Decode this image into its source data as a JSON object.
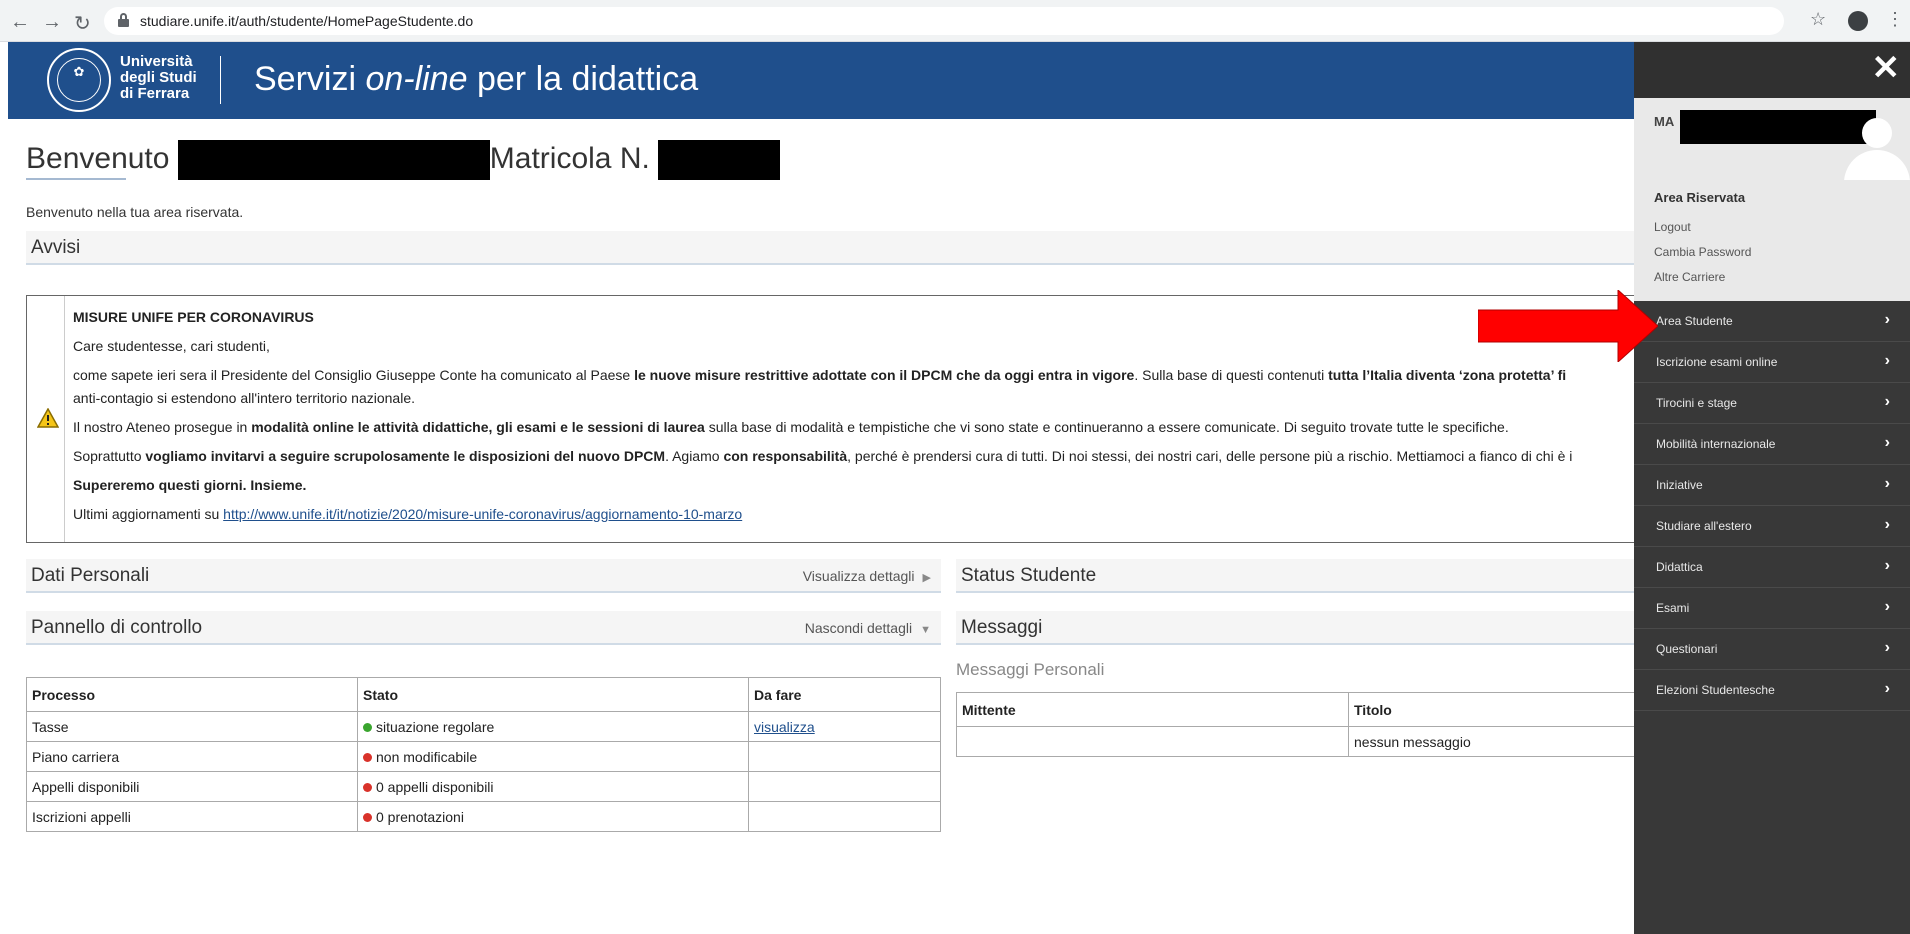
{
  "browser": {
    "url": "studiare.unife.it/auth/studente/HomePageStudente.do"
  },
  "header": {
    "university_line1": "Università",
    "university_line2": "degli Studi",
    "university_line3": "di Ferrara",
    "title_part1": "Servizi ",
    "title_italic": "on-line",
    "title_part2": " per la didattica"
  },
  "welcome": {
    "title_prefix": "Benvenuto ",
    "title_matricola": "Matricola N. ",
    "subtitle": "Benvenuto nella tua area riservata."
  },
  "avvisi": {
    "heading": "Avvisi",
    "title": "MISURE UNIFE PER CORONAVIRUS",
    "greeting": "Care studentesse, cari studenti,",
    "p1_a": "come sapete ieri sera il Presidente del Consiglio Giuseppe Conte ha comunicato al Paese ",
    "p1_b": "le nuove misure restrittive adottate con il DPCM che da oggi entra in vigore",
    "p1_c": ". Sulla base di questi contenuti ",
    "p1_d": "tutta l’Italia diventa ‘zona protetta’ fi",
    "p1_line2": "anti-contagio si estendono all'intero territorio nazionale.",
    "p2_a": "Il nostro Ateneo prosegue in ",
    "p2_b": "modalità online le attività didattiche, gli esami e le sessioni di laurea",
    "p2_c": " sulla base di modalità e tempistiche che vi sono state e continueranno a essere comunicate. Di seguito trovate tutte le specifiche.",
    "p3_a": "Soprattutto ",
    "p3_b": "vogliamo invitarvi a seguire scrupolosamente le disposizioni del nuovo DPCM",
    "p3_c": ". Agiamo ",
    "p3_d": "con responsabilità",
    "p3_e": ", perché è prendersi cura di tutti. Di noi stessi, dei nostri cari, delle persone più a rischio. Mettiamoci a fianco di chi è i",
    "p4": "Supereremo questi giorni. Insieme.",
    "p5_a": "Ultimi aggiornamenti su ",
    "p5_link": "http://www.unife.it/it/notizie/2020/misure-unife-coronavirus/aggiornamento-10-marzo"
  },
  "dati_personali": {
    "heading": "Dati Personali",
    "link": "Visualizza dettagli"
  },
  "status_studente": {
    "heading": "Status Studente"
  },
  "pannello": {
    "heading": "Pannello di controllo",
    "link": "Nascondi dettagli",
    "columns": [
      "Processo",
      "Stato",
      "Da fare"
    ],
    "rows": [
      {
        "processo": "Tasse",
        "stato": "situazione regolare",
        "status_color": "#3aa52e",
        "da_fare": "visualizza"
      },
      {
        "processo": "Piano carriera",
        "stato": "non modificabile",
        "status_color": "#d9322a",
        "da_fare": ""
      },
      {
        "processo": "Appelli disponibili",
        "stato": "0 appelli disponibili",
        "status_color": "#d9322a",
        "da_fare": ""
      },
      {
        "processo": "Iscrizioni appelli",
        "stato": "0 prenotazioni",
        "status_color": "#d9322a",
        "da_fare": ""
      }
    ]
  },
  "messaggi": {
    "heading": "Messaggi",
    "subheading": "Messaggi Personali",
    "columns": [
      "Mittente",
      "Titolo"
    ],
    "empty": "nessun messaggio"
  },
  "sidebar": {
    "close": "✕",
    "user_initials": "MA",
    "area_title": "Area Riservata",
    "links": [
      "Logout",
      "Cambia Password",
      "Altre Carriere"
    ],
    "menu": [
      "Area Studente",
      "Iscrizione esami online",
      "Tirocini e stage",
      "Mobilità internazionale",
      "Iniziative",
      "Studiare all'estero",
      "Didattica",
      "Esami",
      "Questionari",
      "Elezioni Studentesche"
    ]
  },
  "colors": {
    "brand_blue": "#1f4f8c",
    "sidebar_dark": "#383838",
    "annotation_red": "#ff0000"
  }
}
